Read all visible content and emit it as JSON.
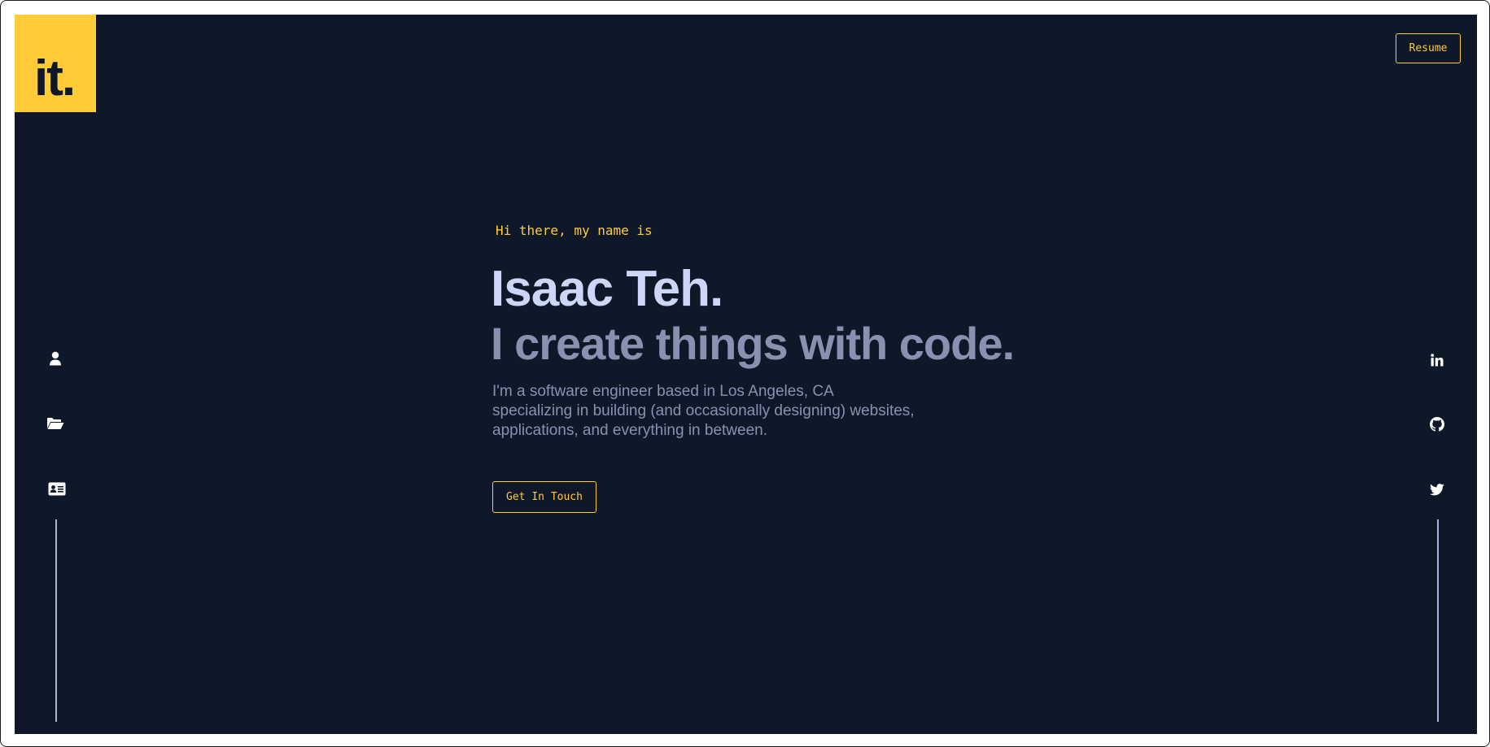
{
  "brand": {
    "logo_text": "it.",
    "accent_color": "#ffcb36",
    "background_color": "#0f1829"
  },
  "header": {
    "resume_label": "Resume"
  },
  "left_nav": {
    "items": [
      {
        "icon": "user-icon"
      },
      {
        "icon": "folder-open-icon"
      },
      {
        "icon": "contact-card-icon"
      }
    ]
  },
  "right_social": {
    "items": [
      {
        "icon": "linkedin-icon"
      },
      {
        "icon": "github-icon"
      },
      {
        "icon": "twitter-icon"
      }
    ]
  },
  "hero": {
    "greeting": "Hi there, my name is",
    "name": "Isaac Teh.",
    "tagline": "I create things with code.",
    "bio": "I'm a software engineer based in Los Angeles, CA specializing in building (and occasionally designing) websites, applications, and everything in between.",
    "cta_label": "Get In Touch"
  }
}
